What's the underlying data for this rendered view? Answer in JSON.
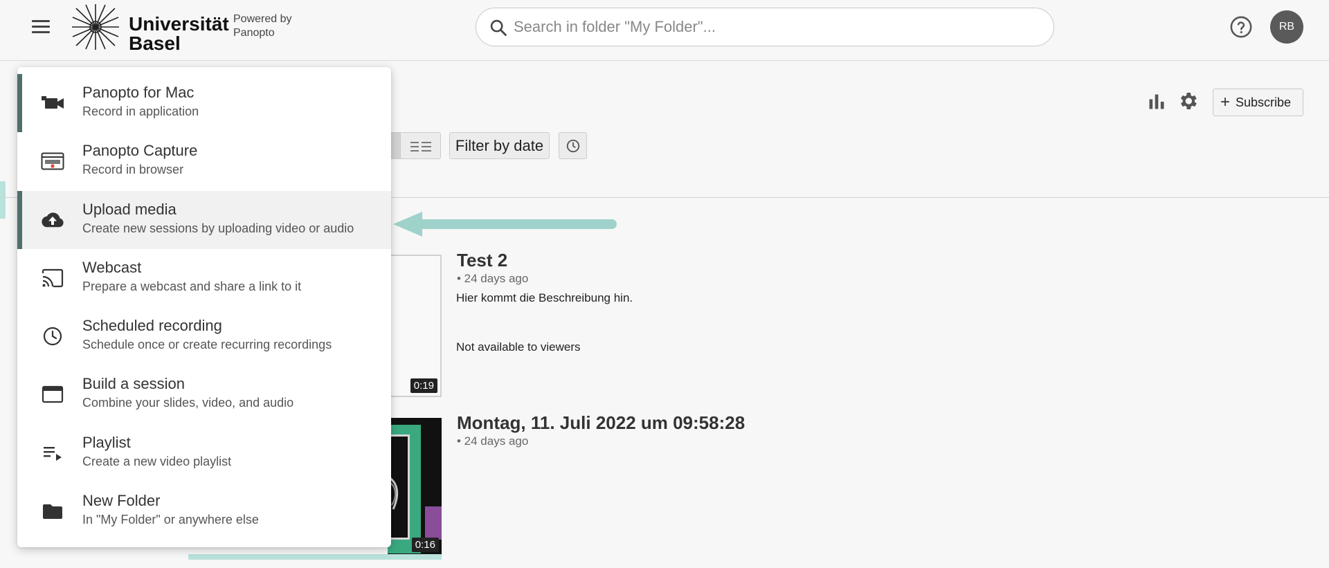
{
  "header": {
    "logo_line1": "Universität",
    "logo_line2": "Basel",
    "powered_line1": "Powered by",
    "powered_line2": "Panopto",
    "search_placeholder": "Search in folder \"My Folder\"...",
    "avatar_initials": "RB"
  },
  "toolbar": {
    "subscribe_label": "Subscribe",
    "filter_by_date_label": "Filter by date"
  },
  "sessions": [
    {
      "title": "Test 2",
      "age": "• 24 days ago",
      "description": "Hier kommt die Beschreibung hin.",
      "availability": "Not available to viewers",
      "duration": "0:19"
    },
    {
      "title": "Montag, 11. Juli 2022 um 09:58:28",
      "age": "• 24 days ago",
      "duration": "0:16"
    }
  ],
  "create_menu": {
    "items": [
      {
        "title": "Panopto for Mac",
        "subtitle": "Record in application",
        "icon": "video-camera-icon",
        "state": "active"
      },
      {
        "title": "Panopto Capture",
        "subtitle": "Record in browser",
        "icon": "browser-record-icon",
        "state": ""
      },
      {
        "title": "Upload media",
        "subtitle": "Create new sessions by uploading video or audio",
        "icon": "cloud-upload-icon",
        "state": "active-hover"
      },
      {
        "title": "Webcast",
        "subtitle": "Prepare a webcast and share a link to it",
        "icon": "cast-icon",
        "state": ""
      },
      {
        "title": "Scheduled recording",
        "subtitle": "Schedule once or create recurring recordings",
        "icon": "clock-icon",
        "state": ""
      },
      {
        "title": "Build a session",
        "subtitle": "Combine your slides, video, and audio",
        "icon": "window-icon",
        "state": ""
      },
      {
        "title": "Playlist",
        "subtitle": "Create a new video playlist",
        "icon": "playlist-icon",
        "state": ""
      },
      {
        "title": "New Folder",
        "subtitle": "In \"My Folder\" or anywhere else",
        "icon": "folder-icon",
        "state": ""
      }
    ]
  },
  "colors": {
    "menu_active_bar": "#4f6f6c",
    "accent_teal": "#9fd2cb"
  }
}
